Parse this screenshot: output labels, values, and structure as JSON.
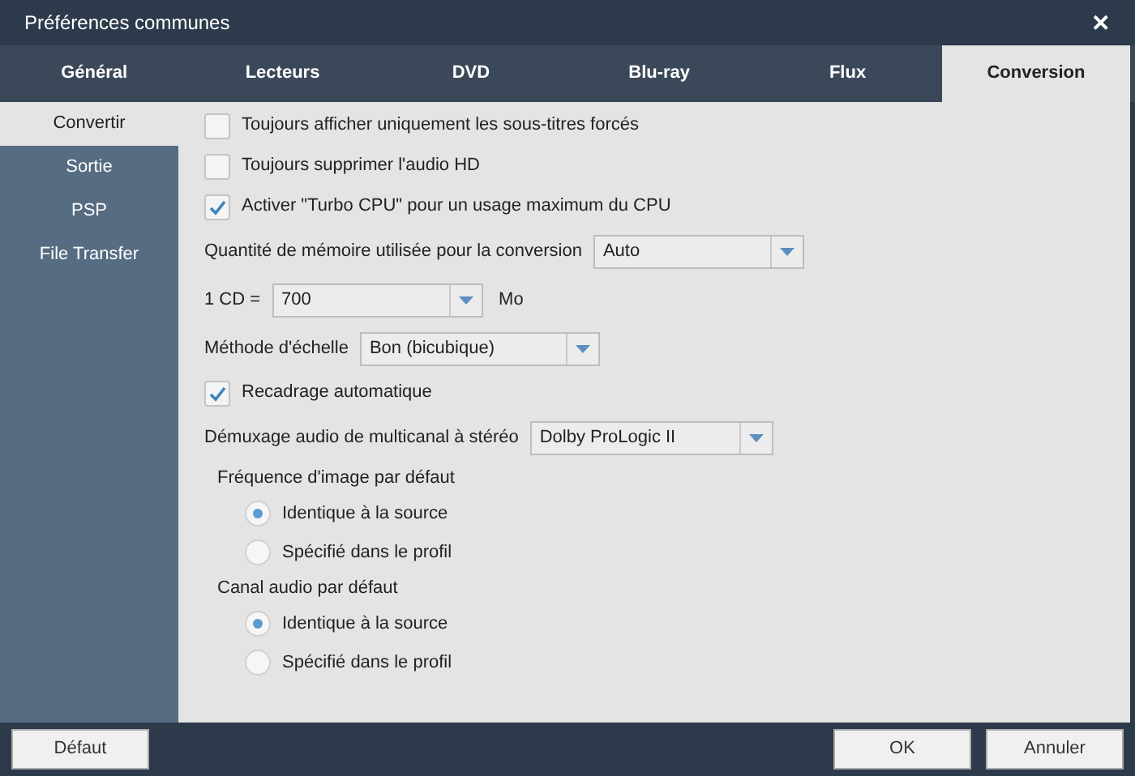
{
  "window": {
    "title": "Préférences communes",
    "close": "✕"
  },
  "tabs": [
    {
      "label": "Général",
      "selected": false
    },
    {
      "label": "Lecteurs",
      "selected": false
    },
    {
      "label": "DVD",
      "selected": false
    },
    {
      "label": "Blu-ray",
      "selected": false
    },
    {
      "label": "Flux",
      "selected": false
    },
    {
      "label": "Conversion",
      "selected": true
    }
  ],
  "sidebar": {
    "items": [
      {
        "label": "Convertir",
        "selected": true
      },
      {
        "label": "Sortie",
        "selected": false
      },
      {
        "label": "PSP",
        "selected": false
      },
      {
        "label": "File Transfer",
        "selected": false
      }
    ]
  },
  "settings": [
    {
      "kind": "checkbox",
      "label": "Toujours afficher uniquement les sous-titres forcés",
      "checked": false
    },
    {
      "kind": "checkbox",
      "label": "Toujours supprimer l'audio HD",
      "checked": false
    },
    {
      "kind": "checkbox",
      "label": "Activer \"Turbo CPU\" pour un usage maximum du CPU",
      "checked": true
    },
    {
      "kind": "select",
      "label": "Quantité de mémoire utilisée pour la conversion",
      "value": "Auto"
    },
    {
      "kind": "select",
      "label": "1 CD =",
      "value": "700",
      "unit": "Mo"
    },
    {
      "kind": "select",
      "label": "Méthode d'échelle",
      "value": "Bon (bicubique)"
    },
    {
      "kind": "checkbox",
      "label": "Recadrage automatique",
      "checked": true
    },
    {
      "kind": "select",
      "label": "Démuxage audio de multicanal à stéréo",
      "value": "Dolby ProLogic II"
    },
    {
      "kind": "group",
      "label": "Fréquence d'image par défaut",
      "options": [
        {
          "label": "Identique à la source",
          "selected": true
        },
        {
          "label": "Spécifié dans le profil",
          "selected": false
        }
      ]
    },
    {
      "kind": "group",
      "label": "Canal audio par défaut",
      "options": [
        {
          "label": "Identique à la source",
          "selected": true
        },
        {
          "label": "Spécifié dans le profil",
          "selected": false
        }
      ]
    }
  ],
  "buttons": {
    "left": "Défaut",
    "ok": "OK",
    "cancel": "Annuler"
  }
}
